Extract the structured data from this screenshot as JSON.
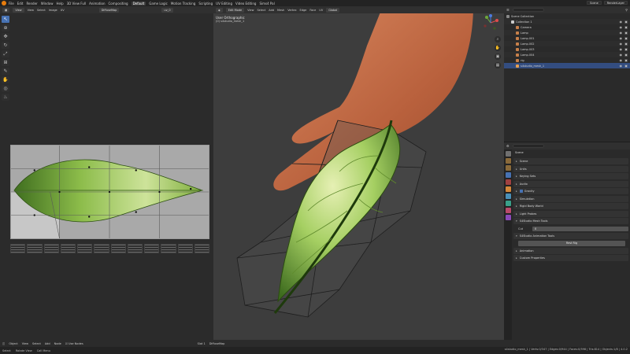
{
  "topbar": {
    "menus": [
      "File",
      "Edit",
      "Render",
      "Window",
      "Help"
    ],
    "workspaces": [
      "3D View Full",
      "Animation",
      "Compositing",
      "Default",
      "Game Logic",
      "Motion Tracking",
      "Scripting",
      "UV Editing",
      "Video Editing",
      "Sims4 Pal"
    ],
    "active_workspace": "Default",
    "scene": "Scene",
    "view_layer": "RenderLayer"
  },
  "uv_editor": {
    "header": {
      "mode": "View",
      "menus": [
        "View",
        "Select",
        "Image",
        "UV"
      ],
      "image_name": "DiffuseMap",
      "slot": "uv_0"
    },
    "tools": [
      "cursor",
      "select",
      "move",
      "rotate",
      "scale",
      "transform",
      "annotate",
      "grab",
      "pinch",
      "relax"
    ]
  },
  "viewport": {
    "header": {
      "mode": "Edit Mode",
      "menus": [
        "View",
        "Select",
        "Add",
        "Mesh",
        "Vertex",
        "Edge",
        "Face",
        "UV"
      ],
      "orientation": "Global"
    },
    "overlay_title": "User Orthographic",
    "overlay_subtitle": "(0) s4studio_mesh_1"
  },
  "outliner": {
    "rows": [
      {
        "label": "Scene Collection",
        "indent": 0,
        "color": "#888888"
      },
      {
        "label": "Collection 1",
        "indent": 1,
        "color": "#cccccc"
      },
      {
        "label": "Camera",
        "indent": 2,
        "color": "#c8804a"
      },
      {
        "label": "Lamp",
        "indent": 2,
        "color": "#c8804a"
      },
      {
        "label": "Lamp.001",
        "indent": 2,
        "color": "#c8804a"
      },
      {
        "label": "Lamp.002",
        "indent": 2,
        "color": "#c8804a"
      },
      {
        "label": "Lamp.003",
        "indent": 2,
        "color": "#c8804a"
      },
      {
        "label": "Lamp.004",
        "indent": 2,
        "color": "#c8804a"
      },
      {
        "label": "rig",
        "indent": 2,
        "color": "#c8804a"
      },
      {
        "label": "s4studio_mesh_1",
        "indent": 2,
        "color": "#e8a050"
      }
    ],
    "selected_index": 9
  },
  "properties": {
    "context": "Scene",
    "panels": [
      {
        "label": "Scene",
        "checkbox": false
      },
      {
        "label": "Units",
        "checkbox": false
      },
      {
        "label": "Keying Sets",
        "checkbox": false
      },
      {
        "label": "Audio",
        "checkbox": false
      },
      {
        "label": "Gravity",
        "checkbox": true
      },
      {
        "label": "Simulation",
        "checkbox": false
      },
      {
        "label": "Rigid Body World",
        "checkbox": false
      },
      {
        "label": "Light Probes",
        "checkbox": false
      },
      {
        "label": "S4Studio Mesh Tools",
        "checkbox": false
      }
    ],
    "cut_label": "Cut",
    "cut_value": "0",
    "anim_panel": "S4Studio Animation Tools",
    "anim_button": "Rest Rig",
    "tail_panels": [
      "Animation",
      "Custom Properties"
    ]
  },
  "statusbar": {
    "uv_header_mode": "Object",
    "uv_header_menus": [
      "View",
      "Select",
      "Add",
      "Node"
    ],
    "use_nodes": "Use Nodes",
    "slot": "Slot 1",
    "material": "DiffuseMap",
    "hints": [
      "Select",
      "Rotate View",
      "Call Menu"
    ],
    "stats": "s4studio_mesh_1 | Verts:0/347 | Edges:0/944 | Faces:0/598 | Tris:814 | Objects:1/8 | 4.0.2"
  },
  "colors": {
    "accent": "#4772b3",
    "leaf_light": "#cde39a",
    "leaf_mid": "#8cbc4a",
    "leaf_dark": "#3f6e1f",
    "skin": "#c06a47"
  }
}
